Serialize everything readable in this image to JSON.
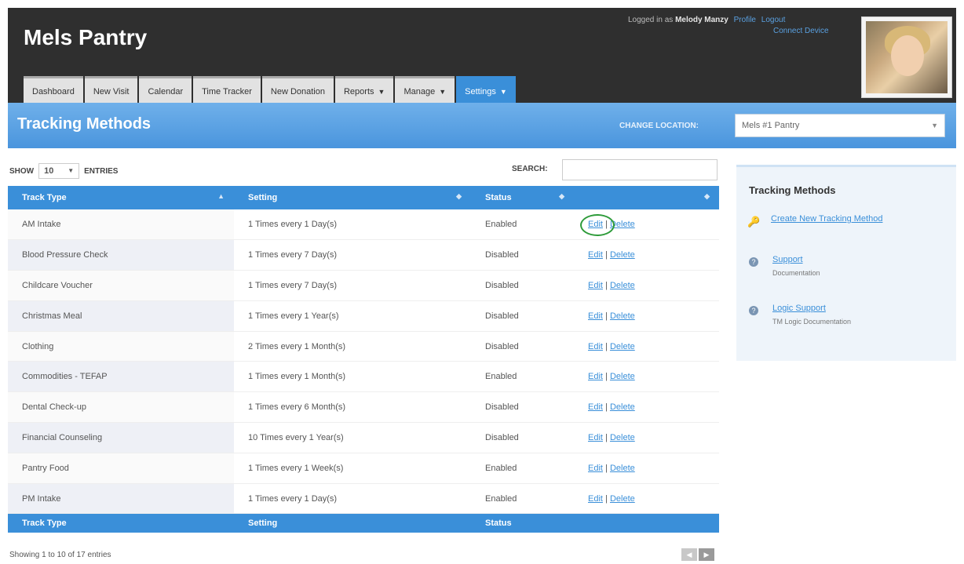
{
  "app": {
    "title": "Mels Pantry",
    "user": {
      "logged_in_prefix": "Logged in as",
      "name": "Melody Manzy",
      "profile_link": "Profile",
      "logout_link": "Logout",
      "connect_link": "Connect Device"
    },
    "nav": [
      {
        "label": "Dashboard"
      },
      {
        "label": "New Visit"
      },
      {
        "label": "Calendar"
      },
      {
        "label": "Time Tracker"
      },
      {
        "label": "New Donation"
      },
      {
        "label": "Reports"
      },
      {
        "label": "Manage"
      },
      {
        "label": "Settings"
      }
    ]
  },
  "page": {
    "title": "Tracking Methods",
    "location_label": "CHANGE LOCATION:",
    "location_value": "Mels #1 Pantry"
  },
  "table_controls": {
    "show_label": "SHOW",
    "show_value": "10",
    "entries_label": "ENTRIES",
    "search_label": "SEARCH:"
  },
  "table": {
    "headers": [
      "Track Type",
      "Setting",
      "Status",
      ""
    ],
    "footer_headers": [
      "Track Type",
      "Setting",
      "Status",
      ""
    ],
    "rows": [
      {
        "type": "AM Intake",
        "setting": "1 Times every 1 Day(s)",
        "status": "Enabled"
      },
      {
        "type": "Blood Pressure Check",
        "setting": "1 Times every 7 Day(s)",
        "status": "Disabled"
      },
      {
        "type": "Childcare Voucher",
        "setting": "1 Times every 7 Day(s)",
        "status": "Disabled"
      },
      {
        "type": "Christmas Meal",
        "setting": "1 Times every 1 Year(s)",
        "status": "Disabled"
      },
      {
        "type": "Clothing",
        "setting": "2 Times every 1 Month(s)",
        "status": "Disabled"
      },
      {
        "type": "Commodities - TEFAP",
        "setting": "1 Times every 1 Month(s)",
        "status": "Enabled"
      },
      {
        "type": "Dental Check-up",
        "setting": "1 Times every 6 Month(s)",
        "status": "Disabled"
      },
      {
        "type": "Financial Counseling",
        "setting": "10 Times every 1 Year(s)",
        "status": "Disabled"
      },
      {
        "type": "Pantry Food",
        "setting": "1 Times every 1 Week(s)",
        "status": "Enabled"
      },
      {
        "type": "PM Intake",
        "setting": "1 Times every 1 Day(s)",
        "status": "Enabled"
      }
    ],
    "edit_label": "Edit",
    "delete_label": "Delete",
    "separator": "|",
    "showing_text": "Showing 1 to 10 of 17 entries"
  },
  "sidebar": {
    "title": "Tracking Methods",
    "create_link": "Create New Tracking Method",
    "support_link": "Support",
    "support_sub": "Documentation",
    "logic_link": "Logic Support",
    "logic_sub": "TM Logic Documentation"
  },
  "colors": {
    "accent": "#3a8fd9",
    "header_bg": "#2f2f2f",
    "highlight_circle": "#2e9b3a"
  }
}
